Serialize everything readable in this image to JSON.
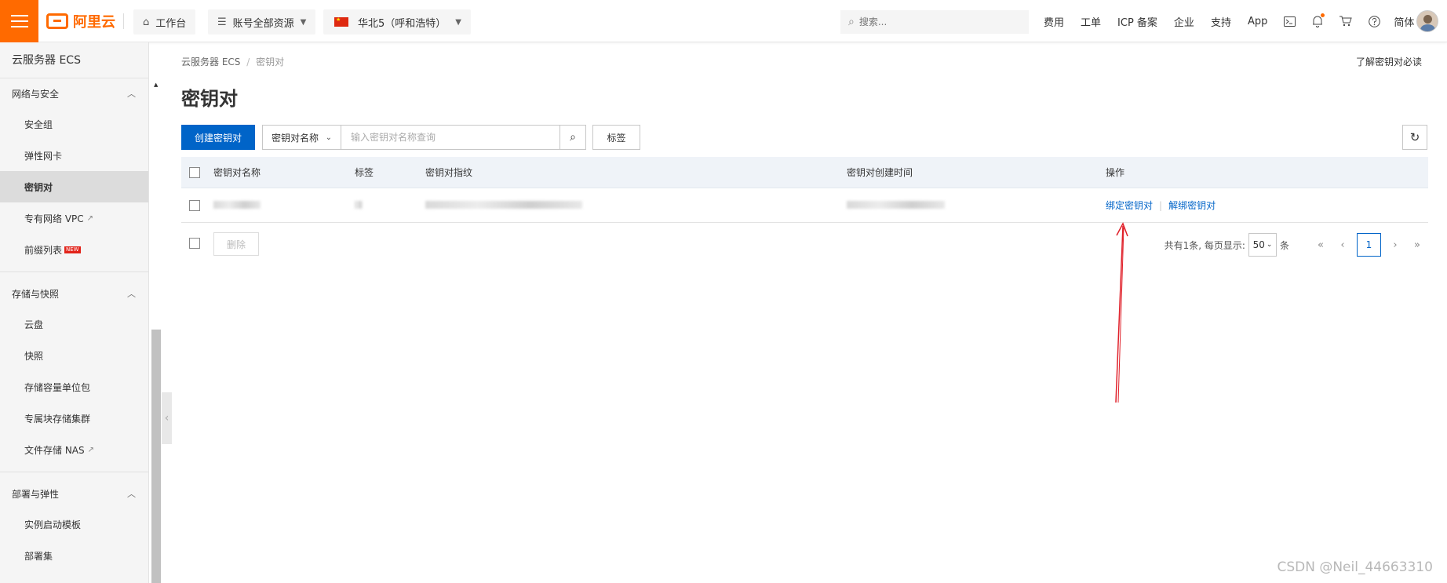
{
  "topbar": {
    "brand": "阿里云",
    "workbench": "工作台",
    "resources": "账号全部资源",
    "region": "华北5（呼和浩特）",
    "search_placeholder": "搜索...",
    "links": [
      "费用",
      "工单",
      "ICP 备案",
      "企业",
      "支持",
      "App"
    ],
    "language": "简体",
    "icons": [
      "terminal-icon",
      "bell-icon",
      "cart-icon",
      "help-icon"
    ]
  },
  "sidebar": {
    "title": "云服务器 ECS",
    "groups": [
      {
        "label": "网络与安全",
        "items": [
          "安全组",
          "弹性网卡",
          "密钥对",
          "专有网络 VPC",
          "前缀列表"
        ]
      },
      {
        "label": "存储与快照",
        "items": [
          "云盘",
          "快照",
          "存储容量单位包",
          "专属块存储集群",
          "文件存储 NAS"
        ]
      },
      {
        "label": "部署与弹性",
        "items": [
          "实例启动模板",
          "部署集"
        ]
      }
    ],
    "new_badge": "NEW",
    "active_item": "密钥对"
  },
  "main": {
    "breadcrumb": [
      "云服务器 ECS",
      "密钥对"
    ],
    "help_link": "了解密钥对必读",
    "title": "密钥对",
    "create_button": "创建密钥对",
    "filter_field": "密钥对名称",
    "filter_placeholder": "输入密钥对名称查询",
    "tag_button": "标签",
    "columns": [
      "密钥对名称",
      "标签",
      "密钥对指纹",
      "密钥对创建时间",
      "操作"
    ],
    "row_actions": [
      "绑定密钥对",
      "解绑密钥对"
    ],
    "delete_button": "删除",
    "pagination": {
      "summary": "共有1条, 每页显示:",
      "page_size": "50",
      "unit": "条",
      "current_page": "1"
    }
  },
  "watermark": "CSDN @Neil_44663310",
  "colors": {
    "brand": "#ff6a00",
    "primary": "#0064c8",
    "annotation_arrow": "#e0202a"
  }
}
